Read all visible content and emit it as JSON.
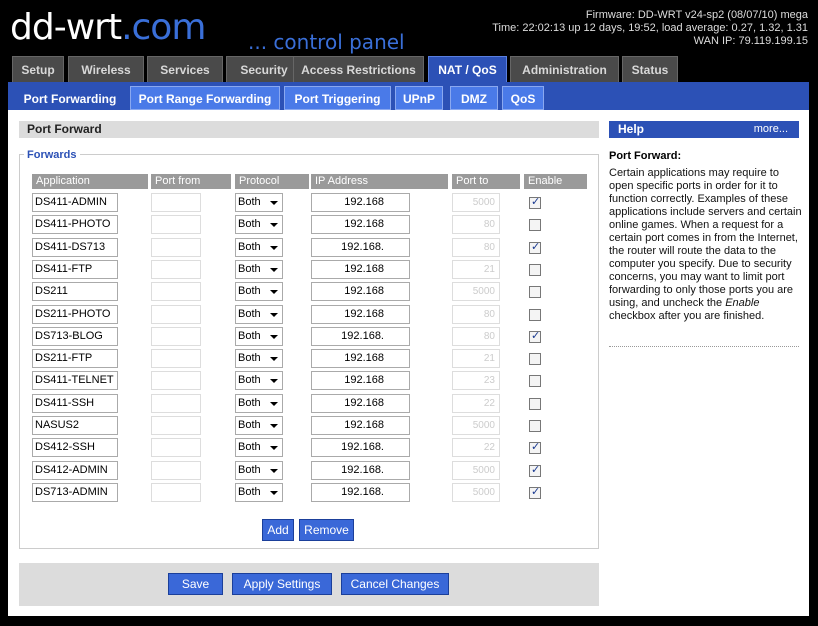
{
  "header": {
    "logo_main": "dd-wrt",
    "logo_suffix": ".com",
    "tagline": "... control panel",
    "firmware": "Firmware: DD-WRT v24-sp2 (08/07/10) mega",
    "time": "Time: 22:02:13 up 12 days, 19:52, load average: 0.27, 1.32, 1.31",
    "wan_ip": "WAN IP: 79.119.199.15"
  },
  "main_tabs": [
    "Setup",
    "Wireless",
    "Services",
    "Security",
    "Access Restrictions",
    "NAT / QoS",
    "Administration",
    "Status"
  ],
  "active_main_tab": "NAT / QoS",
  "sub_tabs": [
    "Port Forwarding",
    "Port Range Forwarding",
    "Port Triggering",
    "UPnP",
    "DMZ",
    "QoS"
  ],
  "active_sub_tab": "Port Forwarding",
  "section_title": "Port Forward",
  "legend": "Forwards",
  "columns": [
    "Application",
    "Port from",
    "Protocol",
    "IP Address",
    "Port to",
    "Enable"
  ],
  "rows": [
    {
      "app": "DS411-ADMIN",
      "protocol": "Both",
      "ip": "192.168",
      "port_to": "5000",
      "enabled": true
    },
    {
      "app": "DS411-PHOTO",
      "protocol": "Both",
      "ip": "192.168",
      "port_to": "80",
      "enabled": false
    },
    {
      "app": "DS411-DS713",
      "protocol": "Both",
      "ip": "192.168.",
      "port_to": "80",
      "enabled": true
    },
    {
      "app": "DS411-FTP",
      "protocol": "Both",
      "ip": "192.168",
      "port_to": "21",
      "enabled": false
    },
    {
      "app": "DS211",
      "protocol": "Both",
      "ip": "192.168",
      "port_to": "5000",
      "enabled": false
    },
    {
      "app": "DS211-PHOTO",
      "protocol": "Both",
      "ip": "192.168",
      "port_to": "80",
      "enabled": false
    },
    {
      "app": "DS713-BLOG",
      "protocol": "Both",
      "ip": "192.168.",
      "port_to": "80",
      "enabled": true
    },
    {
      "app": "DS211-FTP",
      "protocol": "Both",
      "ip": "192.168",
      "port_to": "21",
      "enabled": false
    },
    {
      "app": "DS411-TELNET",
      "protocol": "Both",
      "ip": "192.168",
      "port_to": "23",
      "enabled": false
    },
    {
      "app": "DS411-SSH",
      "protocol": "Both",
      "ip": "192.168",
      "port_to": "22",
      "enabled": false
    },
    {
      "app": "NASUS2",
      "protocol": "Both",
      "ip": "192.168",
      "port_to": "5000",
      "enabled": false
    },
    {
      "app": "DS412-SSH",
      "protocol": "Both",
      "ip": "192.168.",
      "port_to": "22",
      "enabled": true
    },
    {
      "app": "DS412-ADMIN",
      "protocol": "Both",
      "ip": "192.168.",
      "port_to": "5000",
      "enabled": true
    },
    {
      "app": "DS713-ADMIN",
      "protocol": "Both",
      "ip": "192.168.",
      "port_to": "5000",
      "enabled": true
    }
  ],
  "buttons": {
    "add": "Add",
    "remove": "Remove",
    "save": "Save",
    "apply": "Apply Settings",
    "cancel": "Cancel Changes"
  },
  "help": {
    "title": "Help",
    "more": "more...",
    "heading": "Port Forward:",
    "text_before": "Certain applications may require to open specific ports in order for it to function correctly. Examples of these applications include servers and certain online games. When a request for a certain port comes in from the Internet, the router will route the data to the computer you specify. Due to security concerns, you may want to limit port forwarding to only those ports you are using, and uncheck the ",
    "text_em": "Enable",
    "text_after": " checkbox after you are finished."
  }
}
